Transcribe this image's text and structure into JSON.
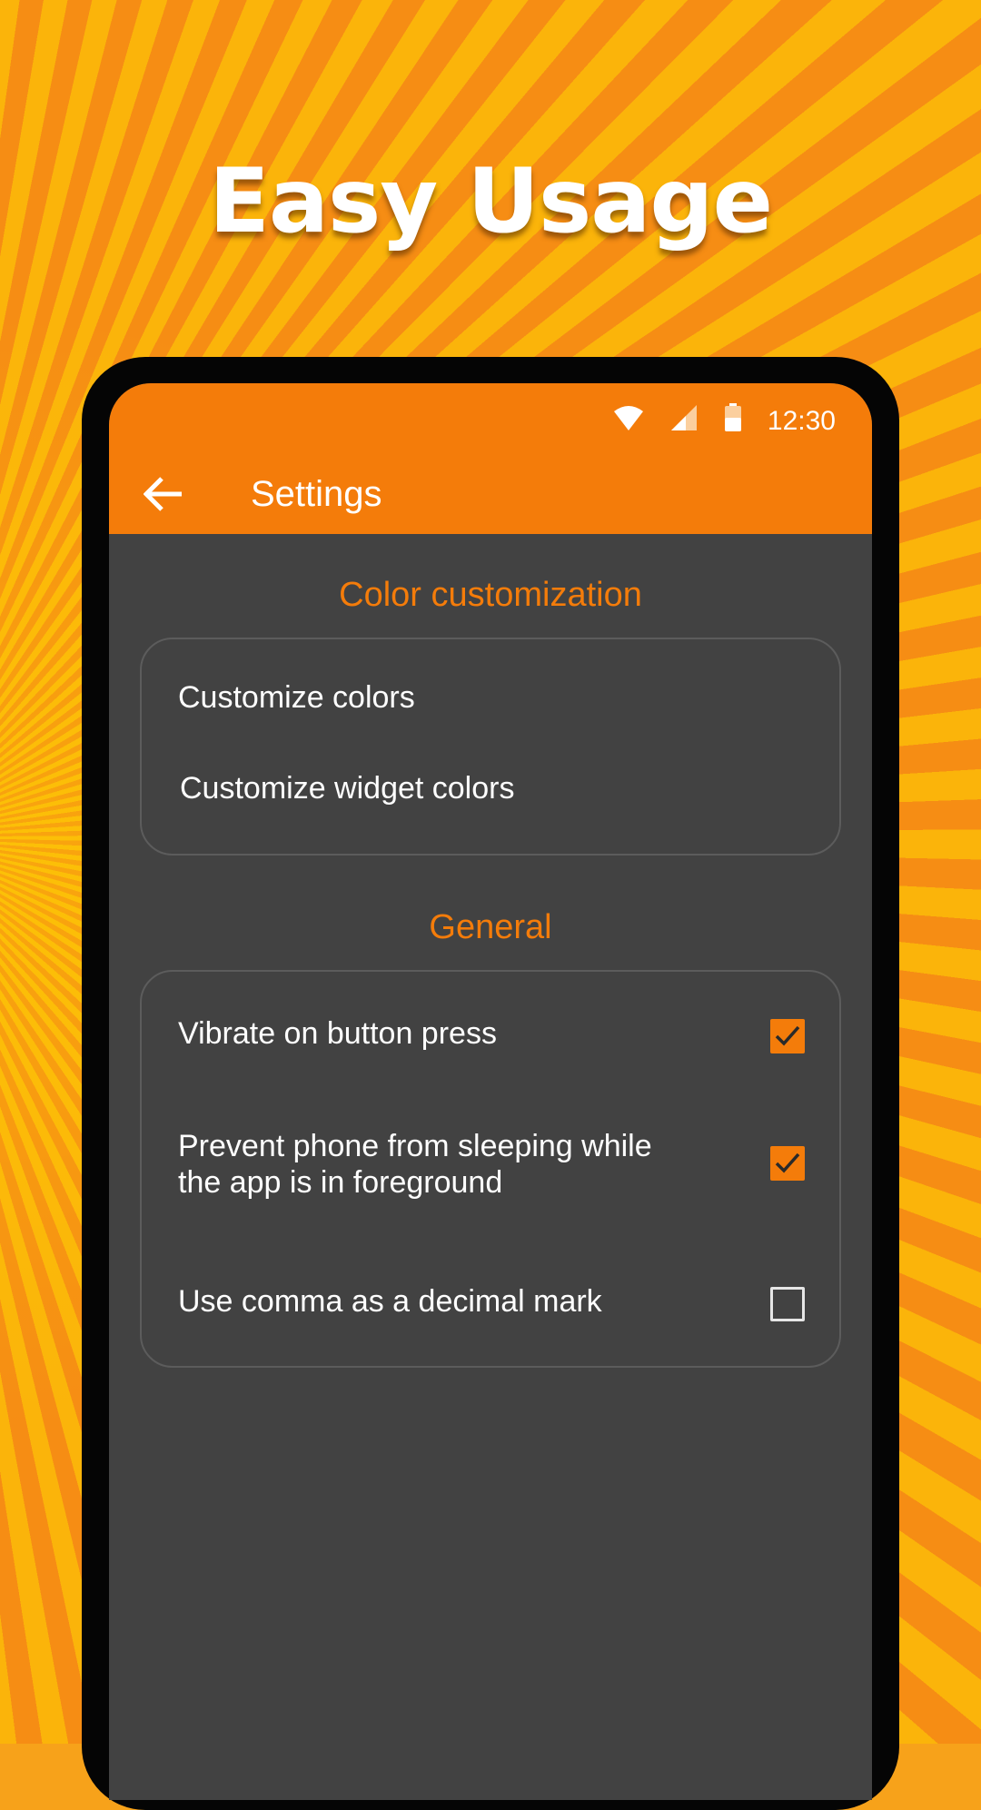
{
  "headline": "Easy Usage",
  "status_bar": {
    "time": "12:30"
  },
  "toolbar": {
    "title": "Settings"
  },
  "sections": [
    {
      "title": "Color customization",
      "items": [
        {
          "label": "Customize colors"
        },
        {
          "label": "Customize widget colors"
        }
      ]
    },
    {
      "title": "General",
      "items": [
        {
          "label": "Vibrate on button press",
          "checked": true
        },
        {
          "label": "Prevent phone from sleeping while the app is in foreground",
          "checked": true
        },
        {
          "label": "Use comma as a decimal mark",
          "checked": false
        }
      ]
    }
  ],
  "colors": {
    "accent": "#f47c0a",
    "background": "#424242",
    "card_border": "#5c5c5c",
    "promo_background": "#f7a21a"
  }
}
